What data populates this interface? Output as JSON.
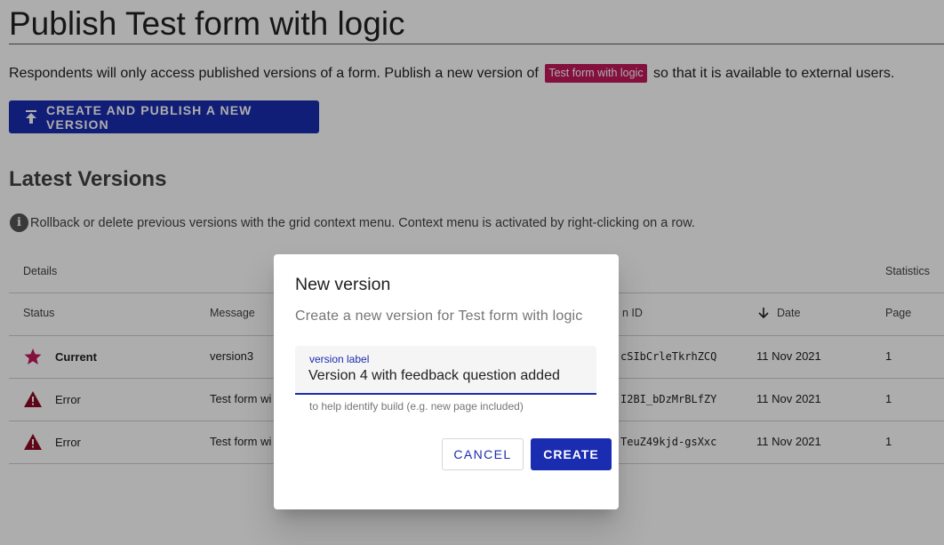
{
  "page": {
    "title": "Publish Test form with logic",
    "intro_before": "Respondents will only access published versions of a form. Publish a new version of",
    "intro_chip": "Test form with logic",
    "intro_after": "so that it is available to external users.",
    "publish_button": "CREATE AND PUBLISH A NEW VERSION",
    "section_title": "Latest Versions",
    "info_text": "Rollback or delete previous versions with the grid context menu. Context menu is activated by right-clicking on a row."
  },
  "table": {
    "groups": {
      "details": "Details",
      "statistics": "Statistics"
    },
    "columns": {
      "status": "Status",
      "message": "Message",
      "version_id": "n ID",
      "date": "Date",
      "page": "Page"
    },
    "rows": [
      {
        "status": "Current",
        "status_icon": "star-icon",
        "message": "version3",
        "version_id": "cSIbCrleTkrhZCQ",
        "date": "11 Nov 2021",
        "page": "1"
      },
      {
        "status": "Error",
        "status_icon": "warning-icon",
        "message": "Test form wi",
        "version_id": "I2BI_bDzMrBLfZY",
        "date": "11 Nov 2021",
        "page": "1"
      },
      {
        "status": "Error",
        "status_icon": "warning-icon",
        "message": "Test form wi",
        "version_id": "TeuZ49kjd-gsXxc",
        "date": "11 Nov 2021",
        "page": "1"
      }
    ]
  },
  "dialog": {
    "title": "New version",
    "subtitle": "Create a new version for Test form with logic",
    "field_label": "version label",
    "field_value": "Version 4 with feedback question added",
    "hint": "to help identify build (e.g. new page included)",
    "cancel": "CANCEL",
    "create": "CREATE"
  },
  "colors": {
    "primary": "#1a2db0",
    "chip": "#c2185b",
    "star": "#c2185b",
    "error": "#8b0a22"
  }
}
